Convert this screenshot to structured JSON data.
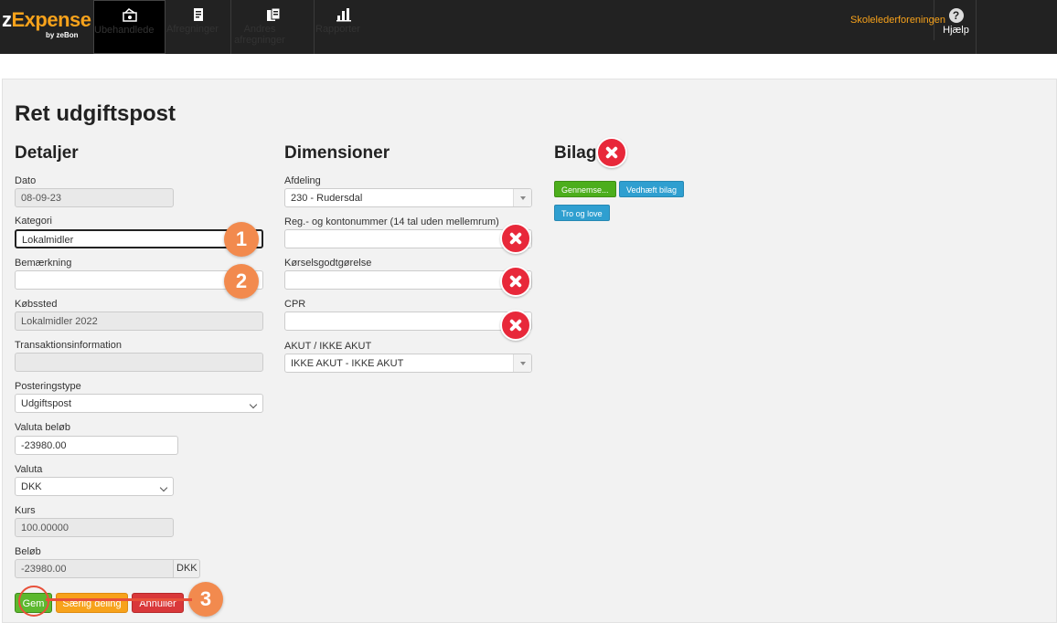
{
  "app": {
    "logo": "zExpense",
    "logo_by": "by zeBon"
  },
  "nav": {
    "items": [
      {
        "label": "Ubehandlede"
      },
      {
        "label": "Afregninger"
      },
      {
        "label": "Andres afregninger"
      },
      {
        "label": "Rapporter"
      }
    ],
    "org": "Skolelederforeningen",
    "help": "Hjælp"
  },
  "page": {
    "title": "Ret udgiftspost"
  },
  "details": {
    "heading": "Detaljer",
    "dato_label": "Dato",
    "dato_value": "08-09-23",
    "kategori_label": "Kategori",
    "kategori_value": "Lokalmidler",
    "bemaerkning_label": "Bemærkning",
    "bemaerkning_value": "",
    "kobssted_label": "Købssted",
    "kobssted_value": "Lokalmidler 2022",
    "trans_label": "Transaktionsinformation",
    "trans_value": "",
    "postering_label": "Posteringstype",
    "postering_value": "Udgiftspost",
    "valuta_belob_label": "Valuta beløb",
    "valuta_belob_value": "-23980.00",
    "valuta_label": "Valuta",
    "valuta_value": "DKK",
    "kurs_label": "Kurs",
    "kurs_value": "100.00000",
    "belob_label": "Beløb",
    "belob_value": "-23980.00",
    "belob_unit": "DKK"
  },
  "dimensions": {
    "heading": "Dimensioner",
    "afdeling_label": "Afdeling",
    "afdeling_value": "230 - Rudersdal",
    "reg_label": "Reg.- og kontonummer (14 tal uden mellemrum)",
    "reg_value": "",
    "korsel_label": "Kørselsgodtgørelse",
    "korsel_value": "",
    "cpr_label": "CPR",
    "cpr_value": "",
    "akut_label": "AKUT / IKKE AKUT",
    "akut_value": "IKKE AKUT - IKKE AKUT"
  },
  "bilag": {
    "heading": "Bilag",
    "browse": "Gennemse...",
    "attach": "Vedhæft bilag",
    "tro": "Tro og love"
  },
  "actions": {
    "save": "Gem",
    "split": "Særlig deling",
    "cancel": "Annuller"
  },
  "annotations": {
    "n1": "1",
    "n2": "2",
    "n3": "3"
  },
  "colors": {
    "accent": "#f7a21b",
    "badge": "#f28a4e",
    "error": "#e8283a"
  }
}
